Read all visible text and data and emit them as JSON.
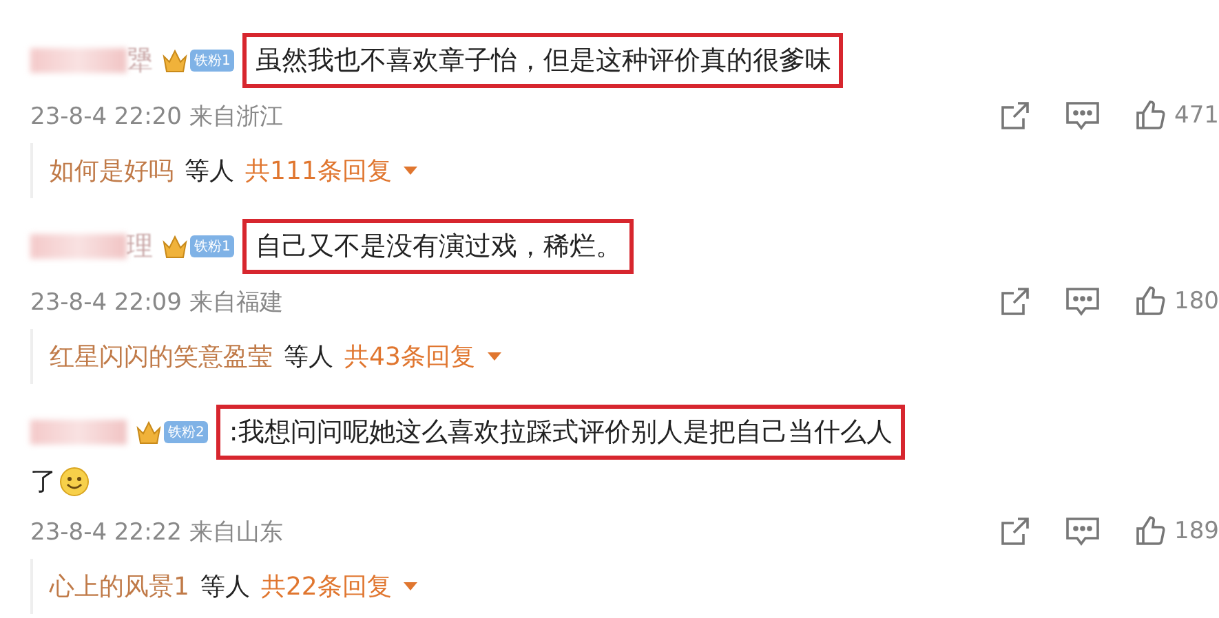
{
  "comments": [
    {
      "name_visible": "犟",
      "badge": "铁粉1",
      "text": "虽然我也不喜欢章子怡，但是这种评价真的很爹味",
      "boxed": true,
      "time": "23-8-4 22:20",
      "location": "来自浙江",
      "likes": "471",
      "reply_user": "如何是好吗",
      "reply_suffix": "等人",
      "reply_count": "共111条回复"
    },
    {
      "name_visible": "理",
      "badge": "铁粉1",
      "text": "自己又不是没有演过戏，稀烂。",
      "boxed": true,
      "time": "23-8-4 22:09",
      "location": "来自福建",
      "likes": "180",
      "reply_user": "红星闪闪的笑意盈莹",
      "reply_suffix": "等人",
      "reply_count": "共43条回复"
    },
    {
      "badge": "铁粉2",
      "text": ":我想问问呢她这么喜欢拉踩式评价别人是把自己当什么人",
      "text_continued": "了",
      "emoji": true,
      "boxed": true,
      "time": "23-8-4 22:22",
      "location": "来自山东",
      "likes": "189",
      "reply_user": "心上的风景1",
      "reply_suffix": "等人",
      "reply_count": "共22条回复"
    }
  ]
}
